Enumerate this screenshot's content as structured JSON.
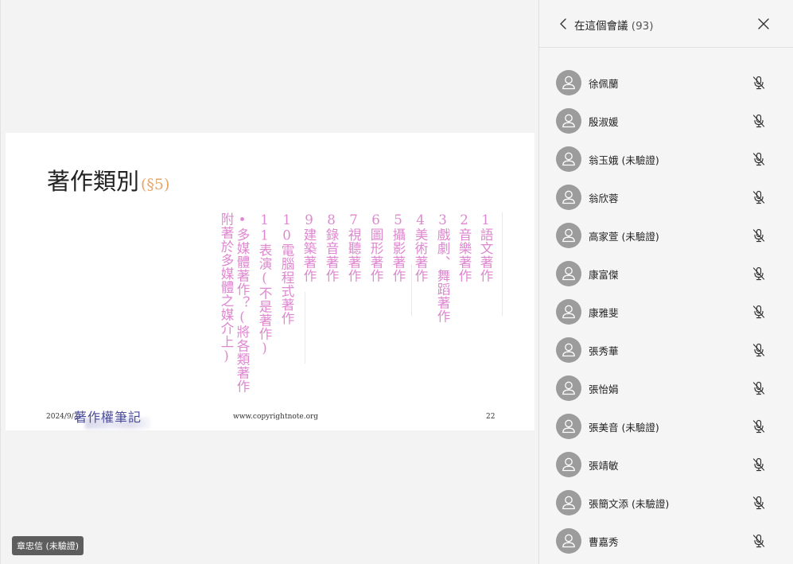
{
  "slide": {
    "title": "著作類別",
    "title_section": "(§5)",
    "columns": [
      "1語文著作",
      "2音樂著作",
      "3戲劇、舞蹈著作",
      "4美術著作",
      "5攝影著作",
      "6圖形著作",
      "7視聽著作",
      "8錄音著作",
      "9建築著作",
      "10電腦程式著作",
      "11表演(不是著作)",
      "•多媒體著作？(將各類著作",
      "附著於多媒體之媒介上)"
    ],
    "footer_date": "2024/9/3",
    "logo_text": "著作權筆記",
    "footer_url": "www.copyrightnote.org",
    "page_number": "22"
  },
  "presenter_tag": "章忠信 (未驗證)",
  "panel": {
    "title": "在這個會議",
    "count": "(93)",
    "participants": [
      {
        "name": "徐佩蘭"
      },
      {
        "name": "殷淑媛"
      },
      {
        "name": "翁玉娥 (未驗證)"
      },
      {
        "name": "翁欣蓉"
      },
      {
        "name": "高家萱 (未驗證)"
      },
      {
        "name": "康富傑"
      },
      {
        "name": "康雅斐"
      },
      {
        "name": "張秀華"
      },
      {
        "name": "張怡娟"
      },
      {
        "name": "張美音 (未驗證)"
      },
      {
        "name": "張靖敏"
      },
      {
        "name": "張簡文添 (未驗證)"
      },
      {
        "name": "曹嘉秀"
      }
    ]
  },
  "icons": {
    "back": "chevron-left-icon",
    "close": "close-icon",
    "avatar": "person-icon",
    "mic": "mic-off-icon"
  },
  "colors": {
    "slide_text_pink": "#df87d0",
    "section_orange": "#e5a66a",
    "avatar_gray": "#9c9c9c"
  }
}
